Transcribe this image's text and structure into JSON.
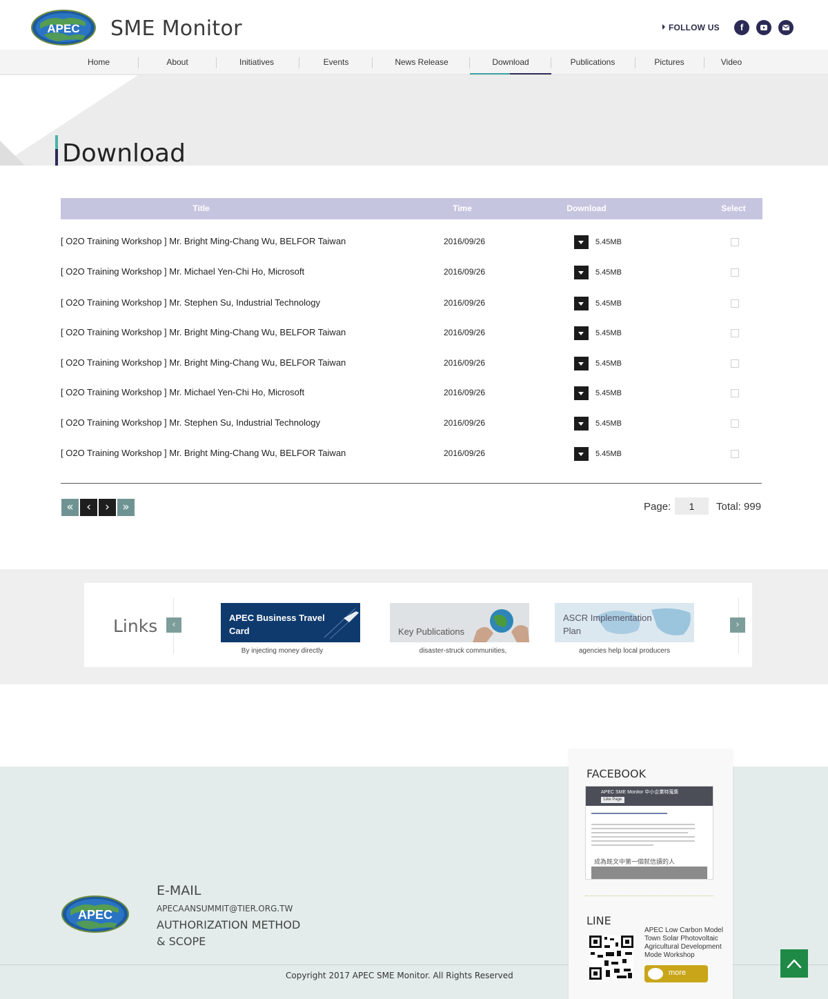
{
  "header": {
    "brand": "APEC",
    "site_title": "SME Monitor",
    "follow_label": "FOLLOW US"
  },
  "nav": {
    "items": [
      {
        "label": "Home"
      },
      {
        "label": "About"
      },
      {
        "label": "Initiatives"
      },
      {
        "label": "Events"
      },
      {
        "label": "News Release"
      },
      {
        "label": "Download",
        "active": true
      },
      {
        "label": "Publications"
      },
      {
        "label": "Pictures"
      },
      {
        "label": "Video"
      }
    ]
  },
  "page": {
    "heading": "Download"
  },
  "table": {
    "headers": {
      "title": "Title",
      "time": "Time",
      "download": "Download",
      "select": "Select"
    },
    "rows": [
      {
        "title": "[ O2O Training Workshop ] Mr. Bright Ming-Chang Wu, BELFOR Taiwan",
        "time": "2016/09/26",
        "size": "5.45MB"
      },
      {
        "title": "[ O2O Training Workshop ] Mr. Michael Yen-Chi Ho, Microsoft",
        "time": "2016/09/26",
        "size": "5.45MB"
      },
      {
        "title": "[ O2O Training Workshop ] Mr. Stephen Su, Industrial Technology",
        "time": "2016/09/26",
        "size": "5.45MB"
      },
      {
        "title": "[ O2O Training Workshop ] Mr. Bright Ming-Chang Wu, BELFOR Taiwan",
        "time": "2016/09/26",
        "size": "5.45MB"
      },
      {
        "title": "[ O2O Training Workshop ] Mr. Bright Ming-Chang Wu, BELFOR Taiwan",
        "time": "2016/09/26",
        "size": "5.45MB"
      },
      {
        "title": "[ O2O Training Workshop ] Mr. Michael Yen-Chi Ho, Microsoft",
        "time": "2016/09/26",
        "size": "5.45MB"
      },
      {
        "title": "[ O2O Training Workshop ] Mr. Stephen Su, Industrial Technology",
        "time": "2016/09/26",
        "size": "5.45MB"
      },
      {
        "title": "[ O2O Training Workshop ] Mr. Bright Ming-Chang Wu, BELFOR Taiwan",
        "time": "2016/09/26",
        "size": "5.45MB"
      }
    ]
  },
  "pagination": {
    "first_icon": "double-chevron-left-icon",
    "prev_icon": "chevron-left-icon",
    "next_icon": "chevron-right-icon",
    "last_icon": "double-chevron-right-icon",
    "page_label": "Page:",
    "page_value": "1",
    "total_label": "Total: 999"
  },
  "links": {
    "title": "Links",
    "cards": [
      {
        "title_line1": "APEC Business Travel",
        "title_line2": "Card",
        "caption": "By injecting money directly"
      },
      {
        "title_line1": "Key Publications",
        "title_line2": "",
        "caption": "disaster-struck communities,"
      },
      {
        "title_line1": "ASCR Implementation",
        "title_line2": "Plan",
        "caption": "agencies help local producers"
      }
    ]
  },
  "footer": {
    "brand": "APEC",
    "email_title": "E-MAIL",
    "email_address": "APECAANSUMMIT@TIER.ORG.TW",
    "auth_line1": "AUTHORIZATION METHOD",
    "auth_line2": "& SCOPE",
    "copyright": "Copyright 2017 APEC SME Monitor. All Rights Reserved"
  },
  "social_panel": {
    "facebook_title": "FACEBOOK",
    "fb_page_name": "APEC SME Monitor 中小企業特蒐集",
    "fb_like": "Like Page",
    "fb_post_text": "成為既文中第一個就信讀的人",
    "line_title": "LINE",
    "line_text": "APEC Low Carbon Model Town Solar Photovoltaic Agricultural Development Mode Workshop",
    "more_label": "more"
  },
  "colors": {
    "nav_active_accent": "#3aa0a0",
    "brand_dark": "#2c2a55",
    "table_header_bg": "#c6c5e0",
    "back_to_top": "#1e8a46"
  }
}
